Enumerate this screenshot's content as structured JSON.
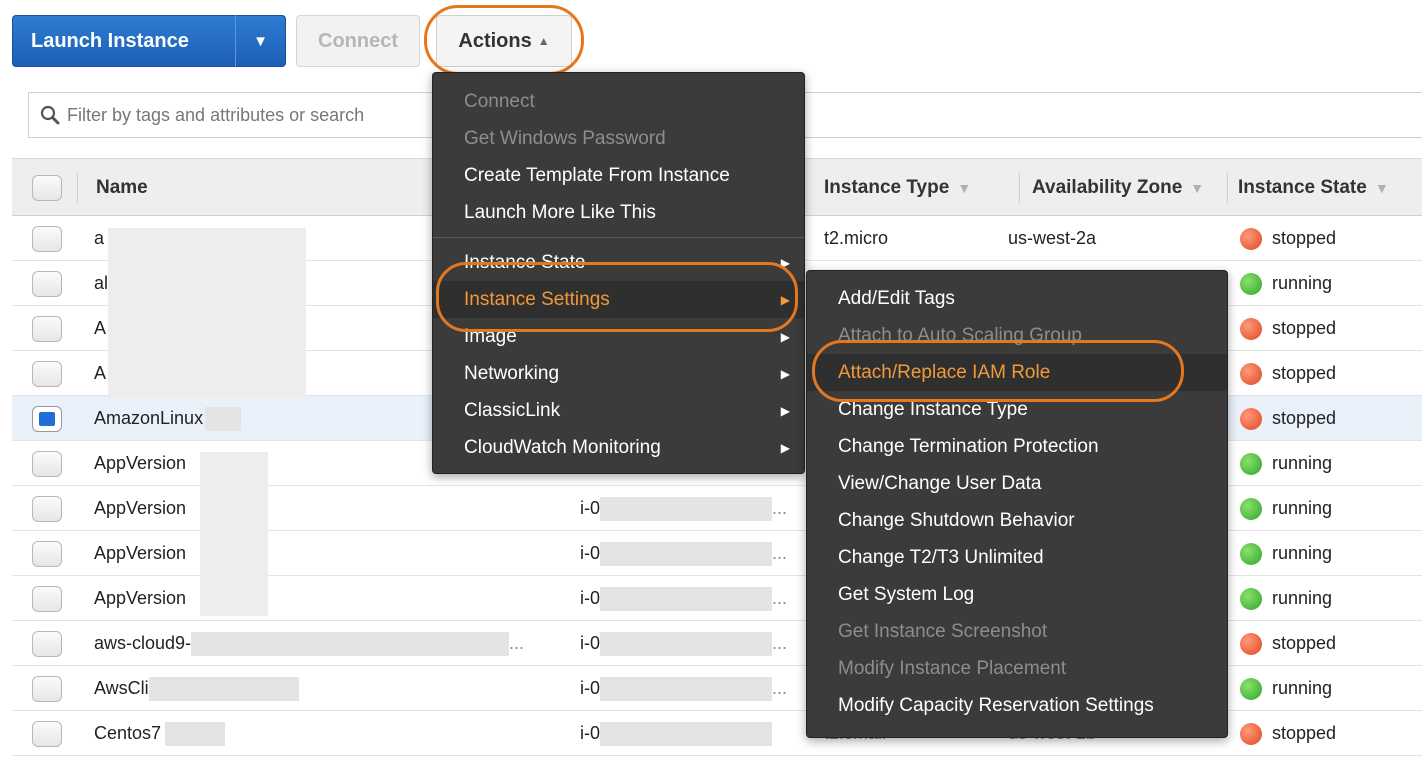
{
  "toolbar": {
    "launch_label": "Launch Instance",
    "connect_label": "Connect",
    "actions_label": "Actions"
  },
  "filter": {
    "placeholder": "Filter by tags and attributes or search"
  },
  "table": {
    "headers": {
      "name": "Name",
      "instance_type": "Instance Type",
      "availability_zone": "Availability Zone",
      "instance_state": "Instance State"
    },
    "rows": [
      {
        "name": "a",
        "id": "",
        "type": "t2.micro",
        "zone": "us-west-2a",
        "state": "stopped"
      },
      {
        "name": "al",
        "id": "",
        "type": "",
        "zone": "",
        "state": "running"
      },
      {
        "name": "A",
        "id": "",
        "type": "",
        "zone": "",
        "state": "stopped"
      },
      {
        "name": "A",
        "id": "",
        "type": "",
        "zone": "",
        "state": "stopped"
      },
      {
        "name": "AmazonLinux",
        "id": "",
        "type": "",
        "zone": "",
        "state": "stopped"
      },
      {
        "name": "AppVersion",
        "id": "",
        "type": "",
        "zone": "",
        "state": "running"
      },
      {
        "name": "AppVersion",
        "id": "i-0",
        "type": "",
        "zone": "",
        "state": "running"
      },
      {
        "name": "AppVersion",
        "id": "i-0",
        "type": "",
        "zone": "",
        "state": "running"
      },
      {
        "name": "AppVersion",
        "id": "i-0",
        "type": "",
        "zone": "",
        "state": "running"
      },
      {
        "name": "aws-cloud9-",
        "id": "i-0",
        "type": "",
        "zone": "",
        "state": "stopped"
      },
      {
        "name": "AwsCli",
        "id": "i-0",
        "type": "",
        "zone": "",
        "state": "running"
      },
      {
        "name": "Centos7",
        "id": "i-0",
        "type": "t2.small",
        "zone": "us-west-2b",
        "state": "stopped"
      }
    ]
  },
  "actions_menu": {
    "items": [
      {
        "label": "Connect",
        "disabled": true
      },
      {
        "label": "Get Windows Password",
        "disabled": true
      },
      {
        "label": "Create Template From Instance",
        "disabled": false
      },
      {
        "label": "Launch More Like This",
        "disabled": false
      },
      {
        "label": "Instance State",
        "submenu": true
      },
      {
        "label": "Instance Settings",
        "submenu": true,
        "active": true
      },
      {
        "label": "Image",
        "submenu": true
      },
      {
        "label": "Networking",
        "submenu": true
      },
      {
        "label": "ClassicLink",
        "submenu": true
      },
      {
        "label": "CloudWatch Monitoring",
        "submenu": true
      }
    ]
  },
  "settings_menu": {
    "items": [
      {
        "label": "Add/Edit Tags",
        "disabled": false
      },
      {
        "label": "Attach to Auto Scaling Group",
        "disabled": true
      },
      {
        "label": "Attach/Replace IAM Role",
        "disabled": false,
        "highlighted": true
      },
      {
        "label": "Change Instance Type",
        "disabled": false
      },
      {
        "label": "Change Termination Protection",
        "disabled": false
      },
      {
        "label": "View/Change User Data",
        "disabled": false
      },
      {
        "label": "Change Shutdown Behavior",
        "disabled": false
      },
      {
        "label": "Change T2/T3 Unlimited",
        "disabled": false
      },
      {
        "label": "Get System Log",
        "disabled": false
      },
      {
        "label": "Get Instance Screenshot",
        "disabled": true
      },
      {
        "label": "Modify Instance Placement",
        "disabled": true
      },
      {
        "label": "Modify Capacity Reservation Settings",
        "disabled": false
      }
    ]
  },
  "colors": {
    "accent_blue": "#1b5fb5",
    "highlight_orange": "#e5781f",
    "state_stopped": "#e0461f",
    "state_running": "#2ea52b",
    "menu_bg": "#3b3b3b"
  },
  "icons": {
    "search": "search-icon",
    "dropdown": "caret-down-icon",
    "collapse": "caret-up-icon",
    "submenu": "chevron-right-icon",
    "sort": "sort-arrow-icon"
  }
}
